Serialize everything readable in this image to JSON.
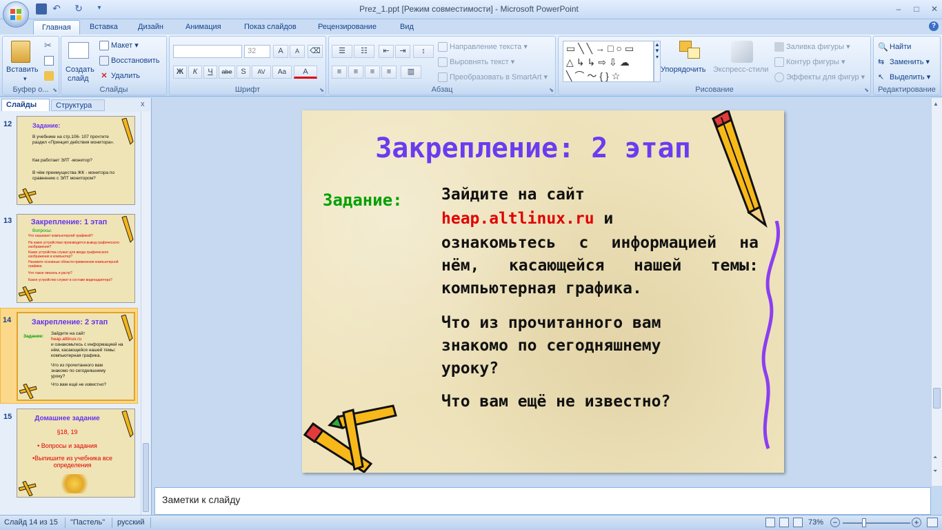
{
  "window": {
    "title": "Prez_1.ppt [Режим совместимости] - Microsoft PowerPoint",
    "controls": {
      "minimize": "–",
      "maximize": "□",
      "close": "✕"
    }
  },
  "ribbon": {
    "tabs": [
      "Главная",
      "Вставка",
      "Дизайн",
      "Анимация",
      "Показ слайдов",
      "Рецензирование",
      "Вид"
    ],
    "active_tab": "Главная",
    "help": "?",
    "groups": {
      "clipboard": {
        "label": "Буфер о...",
        "paste": "Вставить"
      },
      "slides": {
        "label": "Слайды",
        "new_slide": "Создать",
        "new_slide_2": "слайд",
        "layout": "Макет",
        "reset": "Восстановить",
        "delete": "Удалить"
      },
      "font": {
        "label": "Шрифт",
        "font_name": "",
        "font_size": "32",
        "bold": "Ж",
        "italic": "К",
        "underline": "Ч",
        "strike": "abe",
        "shadow": "S",
        "spacing": "AV",
        "case": "Aa",
        "color": "A",
        "grow": "A",
        "shrink": "A"
      },
      "paragraph": {
        "label": "Абзац",
        "text_direction": "Направление текста",
        "align_text": "Выровнять текст",
        "smartart": "Преобразовать в SmartArt"
      },
      "drawing": {
        "label": "Рисование",
        "arrange": "Упорядочить",
        "quick_styles": "Экспресс-стили",
        "shape_fill": "Заливка фигуры",
        "shape_outline": "Контур фигуры",
        "shape_effects": "Эффекты для фигур"
      },
      "editing": {
        "label": "Редактирование",
        "find": "Найти",
        "replace": "Заменить",
        "select": "Выделить"
      }
    }
  },
  "left_panel": {
    "tab_slides": "Слайды",
    "tab_outline": "Структура",
    "close": "x",
    "thumbnails": [
      {
        "number": "12",
        "title": "Задание:",
        "lines": [
          "В учебнике на стр.106- 107 прочтите раздел «Принцип действия монитора».",
          "Как работает ЭЛТ -монитор?",
          "В чём преимущества ЖК - монитора по сравнению с ЭЛТ монитором?"
        ]
      },
      {
        "number": "13",
        "title": "Закрепление: 1 этап",
        "subtitle": "Вопросы:",
        "lines": [
          "Что называют компьютерной графикой?",
          "На каких устройствах производится вывод графического изображения?",
          "Какие устройства служат для ввода графического изображения в компьютер?",
          "Назовите основные области применения компьютерной графики.",
          "Что такое пиксель и растр?",
          "Какое устройство служит в составе видеоадаптера?"
        ]
      },
      {
        "number": "14",
        "title": "Закрепление: 2 этап",
        "label": "Задание:",
        "lines": [
          "Зайдите на сайт",
          "heap.altlinux.ru",
          "и ознакомьтесь с информацией на нём, касающейся нашей темы: компьютерная графика.",
          "Что из прочитанного вам знакомо по сегодняшнему уроку?",
          "Что вам ещё не известно?"
        ]
      },
      {
        "number": "15",
        "title": "Домашнее задание",
        "lines": [
          "§18, 19",
          "• Вопросы и задания",
          "•Выпишите из учебника все определения"
        ]
      }
    ]
  },
  "slide": {
    "title": "Закрепление: 2 этап",
    "label": "Задание:",
    "line1": "Зайдите на сайт",
    "link": "heap.altlinux.ru",
    "after_link": " и",
    "line3": "ознакомьтесь с информацией на нём, касающейся нашей темы: компьютерная графика.",
    "q1": "Что из прочитанного вам знакомо по сегодняшнему уроку?",
    "q2": "Что вам ещё не известно?",
    "colors": {
      "title": "#6a3cf0",
      "label": "#00a000",
      "link": "#e00000",
      "background": "#efe4bd"
    }
  },
  "notes": {
    "placeholder": "Заметки к слайду"
  },
  "status": {
    "slide_info": "Слайд 14 из 15",
    "theme": "\"Пастель\"",
    "language": "русский",
    "zoom": "73%"
  }
}
